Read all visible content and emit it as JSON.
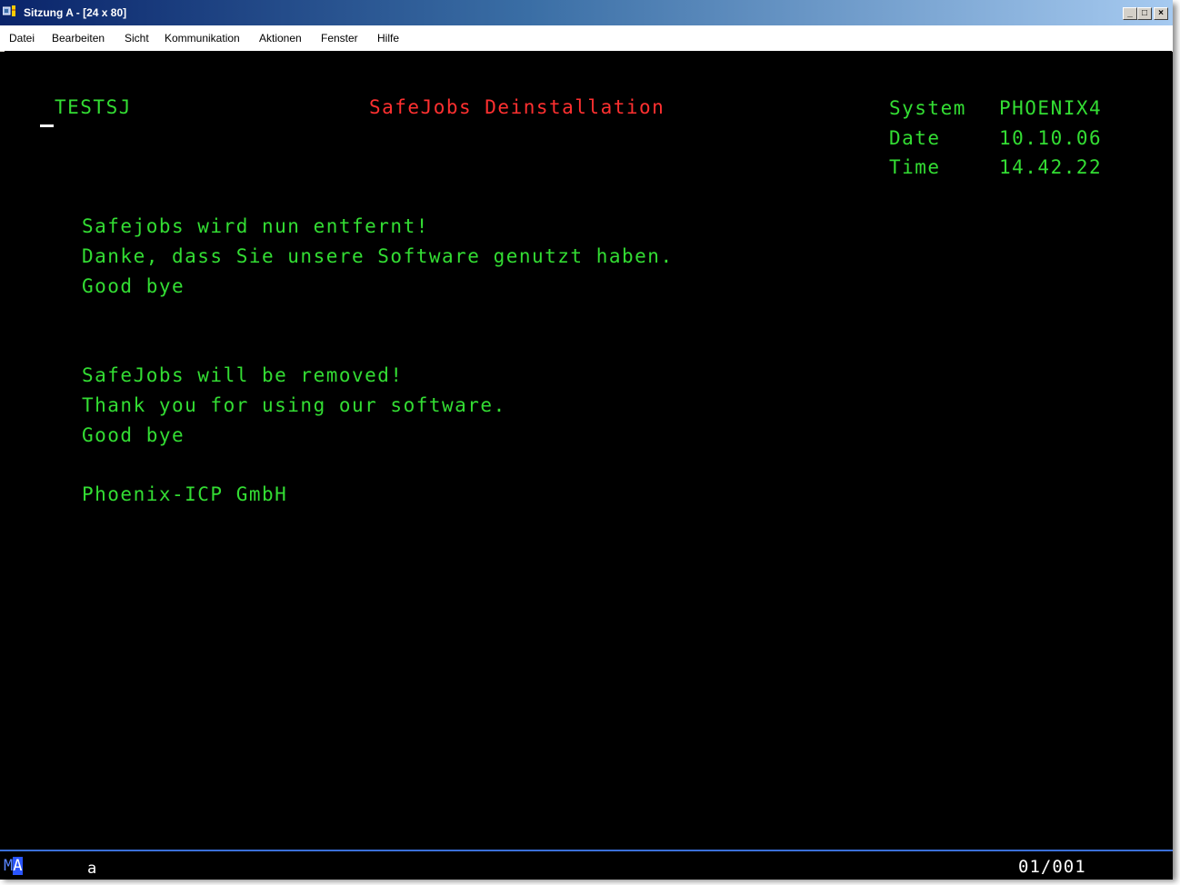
{
  "window": {
    "title": "Sitzung A - [24 x 80]",
    "buttons": {
      "minimize": "_",
      "maximize": "□",
      "close": "×"
    }
  },
  "menu": [
    "Datei",
    "Bearbeiten",
    "Sicht",
    "Kommunikation",
    "Aktionen",
    "Fenster",
    "Hilfe"
  ],
  "screen": {
    "program": "TESTSJ",
    "title": "SafeJobs Deinstallation",
    "system_label": "System",
    "system_value": "PHOENIX4",
    "date_label": "Date",
    "date_value": "10.10.06",
    "time_label": "Time",
    "time_value": "14.42.22",
    "german_lines": [
      "Safejobs wird nun entfernt!",
      "Danke, dass Sie unsere Software genutzt haben.",
      "Good bye"
    ],
    "english_lines": [
      "SafeJobs will be removed!",
      "Thank you for using our software.",
      "Good bye"
    ],
    "company": "Phoenix-ICP GmbH"
  },
  "status": {
    "indicator_m": "M",
    "indicator_a": "A",
    "input_char": "a",
    "cursor_position": "01/001"
  },
  "colors": {
    "screen_bg": "#000000",
    "text_green": "#33dd33",
    "title_red": "#ff3030",
    "titlebar": "#0a246a"
  }
}
